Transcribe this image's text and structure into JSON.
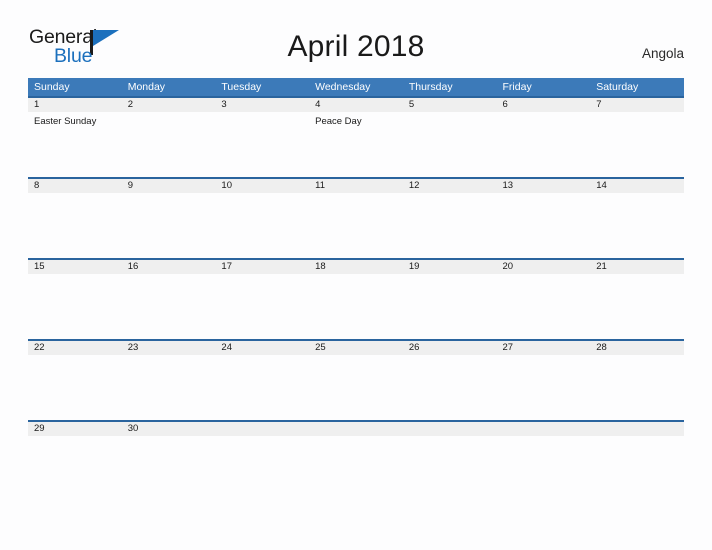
{
  "brand": {
    "name_part1": "General",
    "name_part2": "Blue",
    "flag_icon": "blue-flag-icon",
    "primary_color": "#1c70bd"
  },
  "header": {
    "title": "April 2018",
    "country": "Angola"
  },
  "theme": {
    "header_blue": "#3c7ab9",
    "rule_blue": "#2a649e",
    "date_strip_gray": "#efefef",
    "page_background": "#fdfdfe"
  },
  "calendar": {
    "weekdays": [
      "Sunday",
      "Monday",
      "Tuesday",
      "Wednesday",
      "Thursday",
      "Friday",
      "Saturday"
    ],
    "weeks": [
      {
        "days": [
          {
            "date": "1",
            "events": [
              "Easter Sunday"
            ]
          },
          {
            "date": "2",
            "events": []
          },
          {
            "date": "3",
            "events": []
          },
          {
            "date": "4",
            "events": [
              "Peace Day"
            ]
          },
          {
            "date": "5",
            "events": []
          },
          {
            "date": "6",
            "events": []
          },
          {
            "date": "7",
            "events": []
          }
        ]
      },
      {
        "days": [
          {
            "date": "8",
            "events": []
          },
          {
            "date": "9",
            "events": []
          },
          {
            "date": "10",
            "events": []
          },
          {
            "date": "11",
            "events": []
          },
          {
            "date": "12",
            "events": []
          },
          {
            "date": "13",
            "events": []
          },
          {
            "date": "14",
            "events": []
          }
        ]
      },
      {
        "days": [
          {
            "date": "15",
            "events": []
          },
          {
            "date": "16",
            "events": []
          },
          {
            "date": "17",
            "events": []
          },
          {
            "date": "18",
            "events": []
          },
          {
            "date": "19",
            "events": []
          },
          {
            "date": "20",
            "events": []
          },
          {
            "date": "21",
            "events": []
          }
        ]
      },
      {
        "days": [
          {
            "date": "22",
            "events": []
          },
          {
            "date": "23",
            "events": []
          },
          {
            "date": "24",
            "events": []
          },
          {
            "date": "25",
            "events": []
          },
          {
            "date": "26",
            "events": []
          },
          {
            "date": "27",
            "events": []
          },
          {
            "date": "28",
            "events": []
          }
        ]
      },
      {
        "days": [
          {
            "date": "29",
            "events": []
          },
          {
            "date": "30",
            "events": []
          },
          {
            "date": "",
            "events": []
          },
          {
            "date": "",
            "events": []
          },
          {
            "date": "",
            "events": []
          },
          {
            "date": "",
            "events": []
          },
          {
            "date": "",
            "events": []
          }
        ]
      }
    ]
  }
}
